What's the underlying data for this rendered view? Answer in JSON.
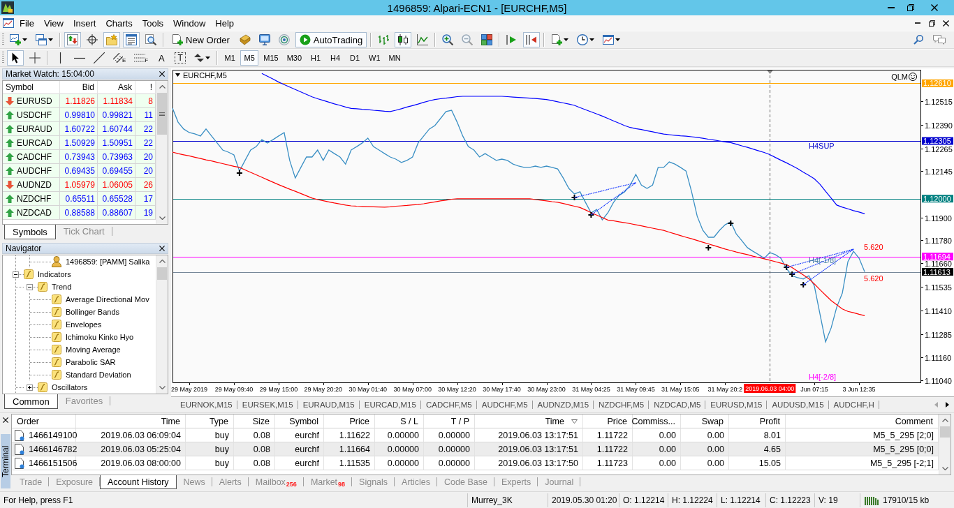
{
  "window": {
    "title": "1496859: Alpari-ECN1 - [EURCHF,M5]"
  },
  "menu": [
    "File",
    "View",
    "Insert",
    "Charts",
    "Tools",
    "Window",
    "Help"
  ],
  "toolbar": [
    {
      "items": [
        {
          "kind": "dropdown",
          "pressed": false
        },
        {
          "kind": "dropdown",
          "pressed": false
        }
      ]
    },
    {
      "items": [
        {
          "kind": "icon",
          "pressed": true
        },
        {
          "kind": "icon",
          "pressed": false
        },
        {
          "kind": "icon",
          "pressed": true
        },
        {
          "kind": "icon",
          "pressed": true
        },
        {
          "kind": "icon",
          "pressed": false
        }
      ]
    },
    {
      "items": [
        {
          "kind": "text",
          "label": "New Order",
          "pressed": false
        },
        {
          "kind": "icon",
          "pressed": false
        },
        {
          "kind": "icon",
          "pressed": false
        },
        {
          "kind": "icon",
          "pressed": false
        },
        {
          "kind": "text",
          "label": "AutoTrading",
          "pressed": true
        }
      ]
    },
    {
      "items": [
        {
          "kind": "icon",
          "pressed": false
        },
        {
          "kind": "icon",
          "pressed": true
        },
        {
          "kind": "icon",
          "pressed": false
        }
      ]
    },
    {
      "items": [
        {
          "kind": "icon",
          "pressed": false
        },
        {
          "kind": "icon",
          "pressed": false
        },
        {
          "kind": "icon",
          "pressed": false
        }
      ]
    },
    {
      "items": [
        {
          "kind": "icon",
          "pressed": false
        },
        {
          "kind": "icon",
          "pressed": true
        }
      ]
    },
    {
      "items": [
        {
          "kind": "dropdown",
          "pressed": false
        },
        {
          "kind": "dropdown",
          "pressed": false
        },
        {
          "kind": "dropdown",
          "pressed": false
        }
      ]
    }
  ],
  "drawing_toolbar": [
    {
      "items": [
        {
          "kind": "icon",
          "pressed": true
        },
        {
          "kind": "icon",
          "pressed": false
        }
      ]
    },
    {
      "items": [
        {
          "kind": "icon",
          "pressed": false
        },
        {
          "kind": "icon",
          "pressed": false
        },
        {
          "kind": "icon",
          "pressed": false
        },
        {
          "kind": "icon",
          "glyph": "E",
          "pressed": false
        },
        {
          "kind": "icon",
          "glyph": "F",
          "pressed": false
        },
        {
          "kind": "letter",
          "label": "A",
          "pressed": false
        },
        {
          "kind": "boxed",
          "label": "T",
          "pressed": false
        },
        {
          "kind": "dropdown",
          "pressed": false
        }
      ]
    }
  ],
  "timeframes": [
    {
      "label": "M1",
      "selected": false
    },
    {
      "label": "M5",
      "selected": true
    },
    {
      "label": "M15",
      "selected": false
    },
    {
      "label": "M30",
      "selected": false
    },
    {
      "label": "H1",
      "selected": false
    },
    {
      "label": "H4",
      "selected": false
    },
    {
      "label": "D1",
      "selected": false
    },
    {
      "label": "W1",
      "selected": false
    },
    {
      "label": "MN",
      "selected": false
    }
  ],
  "market_watch": {
    "title": "Market Watch: 15:04:00",
    "columns": [
      "Symbol",
      "Bid",
      "Ask",
      "!"
    ],
    "rows": [
      {
        "symbol": "EURUSD",
        "bid": "1.11826",
        "ask": "1.11834",
        "spread": "8",
        "rising": false
      },
      {
        "symbol": "USDCHF",
        "bid": "0.99810",
        "ask": "0.99821",
        "spread": "11",
        "rising": true
      },
      {
        "symbol": "EURAUD",
        "bid": "1.60722",
        "ask": "1.60744",
        "spread": "22",
        "rising": true
      },
      {
        "symbol": "EURCAD",
        "bid": "1.50929",
        "ask": "1.50951",
        "spread": "22",
        "rising": true
      },
      {
        "symbol": "CADCHF",
        "bid": "0.73943",
        "ask": "0.73963",
        "spread": "20",
        "rising": true
      },
      {
        "symbol": "AUDCHF",
        "bid": "0.69435",
        "ask": "0.69455",
        "spread": "20",
        "rising": true
      },
      {
        "symbol": "AUDNZD",
        "bid": "1.05979",
        "ask": "1.06005",
        "spread": "26",
        "rising": false
      },
      {
        "symbol": "NZDCHF",
        "bid": "0.65511",
        "ask": "0.65528",
        "spread": "17",
        "rising": true
      },
      {
        "symbol": "NZDCAD",
        "bid": "0.88588",
        "ask": "0.88607",
        "spread": "19",
        "rising": true
      }
    ],
    "tabs": [
      {
        "label": "Symbols",
        "selected": true
      },
      {
        "label": "Tick Chart",
        "selected": false
      }
    ]
  },
  "navigator": {
    "title": "Navigator",
    "tree": [
      {
        "label": "1496859: [PAMM] Salika",
        "kind": "account"
      },
      {
        "label": "Indicators",
        "kind": "folder",
        "expanded": true,
        "children": [
          {
            "label": "Trend",
            "expanded": true,
            "children": [
              {
                "label": "Average Directional Mov"
              },
              {
                "label": "Bollinger Bands"
              },
              {
                "label": "Envelopes"
              },
              {
                "label": "Ichimoku Kinko Hyo"
              },
              {
                "label": "Moving Average"
              },
              {
                "label": "Parabolic SAR"
              },
              {
                "label": "Standard Deviation"
              }
            ]
          },
          {
            "label": "Oscillators",
            "expanded": false
          }
        ]
      }
    ],
    "tabs": [
      {
        "label": "Common",
        "selected": true
      },
      {
        "label": "Favorites",
        "selected": false
      }
    ]
  },
  "chart": {
    "corner_label": "QLM",
    "price_tags": [
      {
        "text": "1.12610",
        "color": "#ffa500"
      },
      {
        "text": "1.12305",
        "color": "#0000cd"
      },
      {
        "text": "1.12000",
        "color": "#008080"
      },
      {
        "text": "1.11694",
        "color": "#ff00ff"
      },
      {
        "text": "1.11613",
        "color": "#000000"
      }
    ],
    "time_tag": {
      "text": "2019.06.03 04:00",
      "color": "#ff0000"
    },
    "chart_data": {
      "type": "line",
      "title": "EURCHF,M5",
      "categories": [
        null,
        null,
        null,
        "29 May 2019",
        null,
        null,
        null,
        null,
        null,
        null,
        null,
        "29 May 09:40",
        null,
        null,
        null,
        null,
        null,
        null,
        null,
        "29 May 15:00",
        null,
        null,
        null,
        null,
        null,
        null,
        null,
        "29 May 20:20",
        null,
        null,
        null,
        null,
        null,
        null,
        null,
        "30 May 01:40",
        null,
        null,
        null,
        null,
        null,
        null,
        null,
        "30 May 07:00",
        null,
        null,
        null,
        null,
        null,
        null,
        null,
        "30 May 12:20",
        null,
        null,
        null,
        null,
        null,
        null,
        null,
        "30 May 17:40",
        null,
        null,
        null,
        null,
        null,
        null,
        null,
        "30 May 23:00",
        null,
        null,
        null,
        null,
        null,
        null,
        null,
        "31 May 04:25",
        null,
        null,
        null,
        null,
        null,
        null,
        null,
        "31 May 09:45",
        null,
        null,
        null,
        null,
        null,
        null,
        null,
        "31 May 15:05",
        null,
        null,
        null,
        null,
        null,
        null,
        null,
        "31 May 20:2",
        null,
        null,
        null,
        null,
        null,
        null,
        null,
        null,
        null,
        null,
        null,
        null,
        null,
        null,
        null,
        "Jun 07:15",
        null,
        null,
        null,
        null,
        null,
        null,
        null,
        "3 Jun 12:35",
        null
      ],
      "series": [
        {
          "color": "#3a8fc4",
          "values": [
            1.12478,
            1.12404,
            1.12368,
            1.12349,
            1.12342,
            1.12331,
            1.12368,
            1.12331,
            1.12294,
            1.12257,
            1.12246,
            1.12231,
            1.12146,
            1.12202,
            1.12257,
            1.12275,
            1.12312,
            1.12294,
            1.12312,
            1.12331,
            1.12349,
            1.12202,
            1.12109,
            1.12165,
            1.1222,
            1.1222,
            1.12257,
            1.12202,
            1.12257,
            1.12238,
            1.1222,
            1.12183,
            1.12257,
            1.12275,
            1.12294,
            1.1232,
            1.12275,
            1.12257,
            1.12238,
            1.1222,
            1.12209,
            1.12191,
            1.12202,
            1.1222,
            1.12294,
            1.12331,
            1.12368,
            1.12386,
            1.12423,
            1.1246,
            1.12467,
            1.12404,
            1.12331,
            1.12275,
            1.12257,
            1.1222,
            1.12238,
            1.1222,
            1.12202,
            1.12209,
            1.12202,
            1.12183,
            1.12172,
            1.12165,
            1.12165,
            1.12172,
            1.12165,
            1.12172,
            1.12165,
            1.12157,
            1.12109,
            1.12054,
            1.12025,
            1.12036,
            1.1198,
            1.11925,
            1.11943,
            1.11888,
            1.11925,
            1.1198,
            1.12017,
            1.12036,
            1.12072,
            1.12128,
            1.12072,
            1.12054,
            1.12072,
            1.12165,
            1.12165,
            1.12194,
            1.12183,
            1.12165,
            1.12146,
            1.12036,
            1.11907,
            1.11833,
            1.11796,
            1.11796,
            1.11833,
            1.11862,
            1.11877,
            1.11814,
            1.11778,
            1.11741,
            1.11722,
            1.11704,
            1.11685,
            1.11715,
            1.11704,
            1.11685,
            1.1163,
            1.11593,
            1.11582,
            1.11575,
            1.11593,
            1.11538,
            1.1139,
            1.11243,
            1.11317,
            1.11427,
            1.11501,
            1.11667,
            1.11722,
            1.11685,
            1.11613
          ]
        },
        {
          "color": "#ff0000",
          "values": [
            1.12246,
            1.12238,
            1.12232,
            1.12226,
            1.12219,
            1.12212,
            1.12205,
            1.12199,
            1.12192,
            1.12185,
            1.12178,
            1.12171,
            1.12165,
            1.12152,
            1.12139,
            1.12126,
            1.12113,
            1.121,
            1.12087,
            1.12074,
            1.12062,
            1.1205,
            1.12039,
            1.12027,
            1.12015,
            1.12003,
            1.11995,
            1.11989,
            1.11983,
            1.11977,
            1.11972,
            1.11966,
            1.11962,
            1.1196,
            1.11959,
            1.11958,
            1.11957,
            1.11956,
            1.11955,
            1.11957,
            1.1196,
            1.11962,
            1.11964,
            1.11967,
            1.11969,
            1.11973,
            1.11978,
            1.11983,
            1.11988,
            1.11992,
            1.11997,
            1.11999,
            1.11999,
            1.11999,
            1.11999,
            1.11999,
            1.11999,
            1.11999,
            1.11999,
            1.11999,
            1.11999,
            1.11999,
            1.11999,
            1.11999,
            1.11999,
            1.11995,
            1.11992,
            1.11988,
            1.11984,
            1.11981,
            1.11974,
            1.11967,
            1.1196,
            1.11953,
            1.1194,
            1.11926,
            1.11913,
            1.119,
            1.11887,
            1.11883,
            1.11878,
            1.11873,
            1.11868,
            1.11862,
            1.11856,
            1.1185,
            1.11844,
            1.11838,
            1.11832,
            1.11823,
            1.11814,
            1.11805,
            1.11796,
            1.11788,
            1.11779,
            1.1177,
            1.11761,
            1.11752,
            1.11743,
            1.11734,
            1.11726,
            1.11718,
            1.11711,
            1.11704,
            1.11696,
            1.11689,
            1.11682,
            1.11675,
            1.11667,
            1.11659,
            1.11651,
            1.11636,
            1.11616,
            1.11597,
            1.11577,
            1.11549,
            1.11519,
            1.1149,
            1.11461,
            1.11439,
            1.11417,
            1.11404,
            1.11397,
            1.11389,
            1.11382
          ]
        },
        {
          "color": "#0000ff",
          "values": [
            null,
            null,
            null,
            null,
            null,
            null,
            null,
            null,
            null,
            null,
            null,
            null,
            null,
            null,
            null,
            null,
            1.12662,
            1.12647,
            1.12632,
            1.12616,
            1.12603,
            1.1259,
            1.12577,
            1.12564,
            1.12551,
            1.12538,
            1.12528,
            1.12519,
            1.1251,
            1.12501,
            1.12493,
            1.12484,
            1.12477,
            1.12475,
            1.12472,
            1.1247,
            1.12467,
            1.12465,
            1.12462,
            1.1246,
            1.12467,
            1.12475,
            1.12484,
            1.12492,
            1.125,
            1.12509,
            1.12517,
            1.12524,
            1.12528,
            1.12531,
            1.12535,
            1.12539,
            1.12541,
            1.12541,
            1.12541,
            1.12541,
            1.12541,
            1.12541,
            1.12541,
            1.12541,
            1.12539,
            1.12537,
            1.12535,
            1.12533,
            1.12531,
            1.12529,
            1.12527,
            1.12524,
            1.12518,
            1.12512,
            1.12506,
            1.125,
            1.12493,
            1.12481,
            1.1247,
            1.12459,
            1.12448,
            1.12436,
            1.12424,
            1.12411,
            1.12399,
            1.12386,
            1.12376,
            1.1237,
            1.12365,
            1.12359,
            1.12353,
            1.12347,
            1.12341,
            1.12338,
            1.12335,
            1.12332,
            1.1233,
            1.12327,
            1.12324,
            1.12319,
            1.12314,
            1.1231,
            1.12305,
            1.123,
            1.12296,
            1.12288,
            1.12279,
            1.12271,
            1.12262,
            1.12253,
            1.12244,
            1.12233,
            1.12218,
            1.12203,
            1.12189,
            1.12174,
            1.12158,
            1.1214,
            1.12123,
            1.12105,
            1.12076,
            1.12039,
            1.12003,
            1.11966,
            1.11955,
            1.11946,
            1.11937,
            1.11929,
            1.1192
          ]
        },
        {
          "color": "#2040ff",
          "line_style": "dotted",
          "values": [
            null,
            null,
            null,
            null,
            null,
            null,
            null,
            null,
            null,
            null,
            null,
            null,
            null,
            null,
            null,
            null,
            null,
            null,
            null,
            null,
            null,
            null,
            null,
            null,
            null,
            null,
            null,
            null,
            null,
            null,
            null,
            null,
            null,
            null,
            null,
            null,
            null,
            null,
            null,
            null,
            null,
            null,
            null,
            null,
            null,
            null,
            null,
            null,
            null,
            null,
            null,
            null,
            null,
            null,
            null,
            null,
            null,
            null,
            null,
            null,
            null,
            null,
            null,
            null,
            null,
            null,
            null,
            null,
            null,
            null,
            null,
            null,
            1.12006,
            1.12013,
            1.1202,
            1.12027,
            1.12034,
            1.12041,
            1.12049,
            1.12056,
            1.12063,
            1.1207,
            1.12077,
            1.12084,
            null,
            null,
            null,
            null,
            null,
            null,
            null,
            null,
            null,
            null,
            null,
            null,
            null,
            null,
            null,
            null,
            null,
            null,
            null,
            null,
            null,
            null,
            null,
            null,
            null,
            null,
            1.11637,
            1.11645,
            1.11653,
            1.11661,
            1.11669,
            1.11677,
            1.11685,
            1.11693,
            1.11701,
            1.11709,
            1.11717,
            1.11725,
            1.11733,
            null,
            null
          ]
        },
        {
          "color": "#2040ff",
          "line_style": "dotted",
          "values": [
            null,
            null,
            null,
            null,
            null,
            null,
            null,
            null,
            null,
            null,
            null,
            null,
            null,
            null,
            null,
            null,
            null,
            null,
            null,
            null,
            null,
            null,
            null,
            null,
            null,
            null,
            null,
            null,
            null,
            null,
            null,
            null,
            null,
            null,
            null,
            null,
            null,
            null,
            null,
            null,
            null,
            null,
            null,
            null,
            null,
            null,
            null,
            null,
            null,
            null,
            null,
            null,
            null,
            null,
            null,
            null,
            null,
            null,
            null,
            null,
            null,
            null,
            null,
            null,
            null,
            null,
            null,
            null,
            null,
            null,
            null,
            null,
            null,
            null,
            null,
            1.11914,
            1.11935,
            1.11956,
            1.11978,
            1.11999,
            1.1202,
            1.12042,
            1.12063,
            1.12084,
            null,
            null,
            null,
            null,
            null,
            null,
            null,
            null,
            null,
            null,
            null,
            null,
            null,
            null,
            null,
            null,
            null,
            null,
            null,
            null,
            null,
            null,
            null,
            null,
            null,
            null,
            null,
            1.11601,
            1.11613,
            1.11625,
            1.11637,
            1.11649,
            1.11661,
            1.11673,
            1.11685,
            1.11697,
            1.11709,
            1.11721,
            1.11733,
            null,
            null
          ]
        },
        {
          "color": "#2040ff",
          "line_style": "dotted",
          "values": [
            null,
            null,
            null,
            null,
            null,
            null,
            null,
            null,
            null,
            null,
            null,
            null,
            null,
            null,
            null,
            null,
            null,
            null,
            null,
            null,
            null,
            null,
            null,
            null,
            null,
            null,
            null,
            null,
            null,
            null,
            null,
            null,
            null,
            null,
            null,
            null,
            null,
            null,
            null,
            null,
            null,
            null,
            null,
            null,
            null,
            null,
            null,
            null,
            null,
            null,
            null,
            null,
            null,
            null,
            null,
            null,
            null,
            null,
            null,
            null,
            null,
            null,
            null,
            null,
            null,
            null,
            null,
            null,
            null,
            null,
            null,
            null,
            null,
            null,
            null,
            null,
            null,
            null,
            null,
            null,
            null,
            null,
            null,
            null,
            null,
            null,
            null,
            null,
            null,
            null,
            null,
            null,
            null,
            null,
            null,
            null,
            null,
            null,
            null,
            null,
            null,
            null,
            null,
            null,
            null,
            null,
            null,
            null,
            null,
            null,
            null,
            null,
            null,
            1.11545,
            1.11566,
            1.11587,
            1.11608,
            1.11629,
            1.1165,
            1.11671,
            1.11692,
            1.11712,
            1.11733,
            null,
            null
          ]
        },
        {
          "type": "scatter",
          "marker": "cross",
          "color": "#000000",
          "values": [
            null,
            null,
            null,
            null,
            null,
            null,
            null,
            null,
            null,
            null,
            null,
            null,
            1.12135,
            null,
            null,
            null,
            null,
            null,
            null,
            null,
            null,
            null,
            null,
            null,
            null,
            null,
            null,
            null,
            null,
            null,
            null,
            null,
            null,
            null,
            null,
            null,
            null,
            null,
            null,
            null,
            null,
            null,
            null,
            null,
            null,
            null,
            null,
            null,
            null,
            null,
            null,
            null,
            null,
            null,
            null,
            null,
            null,
            null,
            null,
            null,
            null,
            null,
            null,
            null,
            null,
            null,
            null,
            null,
            null,
            null,
            null,
            null,
            1.12006,
            null,
            null,
            1.11914,
            null,
            null,
            null,
            null,
            null,
            null,
            null,
            null,
            null,
            null,
            null,
            null,
            null,
            null,
            null,
            null,
            null,
            null,
            null,
            null,
            1.11741,
            null,
            null,
            null,
            1.1187,
            null,
            null,
            null,
            null,
            null,
            null,
            null,
            null,
            null,
            1.11637,
            1.11601,
            null,
            1.11545,
            null,
            null,
            null,
            null,
            null,
            null,
            null,
            null,
            null,
            null,
            null
          ]
        }
      ],
      "ylim": [
        1.11029,
        1.12681
      ],
      "yticks": [
        1.12515,
        {
          "value": 1.1239,
          "label": "1.12390"
        },
        1.12265,
        1.12145,
        {
          "value": 1.119,
          "label": "1.11900"
        },
        {
          "value": 1.1178,
          "label": "1.11780"
        },
        {
          "value": 1.1166,
          "label": "1.11660"
        },
        1.11535,
        {
          "value": 1.1141,
          "label": "1.11410"
        },
        1.11285,
        {
          "value": 1.1116,
          "label": "1.11160"
        },
        {
          "value": 1.1104,
          "label": "1.11040"
        }
      ],
      "ref_lines": [
        {
          "axis": "y",
          "value": 1.1261,
          "color": "#ffa500"
        },
        {
          "axis": "y",
          "value": 1.12305,
          "label": "H4SUP",
          "color": "#0000cd"
        },
        {
          "axis": "y",
          "value": 1.12,
          "color": "#008080"
        },
        {
          "axis": "y",
          "value": 1.11694,
          "color": "#ff00ff"
        },
        {
          "axis": "y",
          "value": 1.11613,
          "color": "#778899"
        }
      ],
      "annotations": [
        "5.620",
        "5.620",
        "H4[-1/8]",
        "H4[-2/8]"
      ]
    },
    "tabs": [
      {
        "label": "EURNOK,M15",
        "selected": false
      },
      {
        "label": "EURSEK,M15",
        "selected": false
      },
      {
        "label": "EURAUD,M15",
        "selected": false
      },
      {
        "label": "EURCAD,M15",
        "selected": false
      },
      {
        "label": "CADCHF,M5",
        "selected": false
      },
      {
        "label": "AUDCHF,M5",
        "selected": false
      },
      {
        "label": "AUDNZD,M15",
        "selected": false
      },
      {
        "label": "NZDCHF,M5",
        "selected": false
      },
      {
        "label": "NZDCAD,M5",
        "selected": false
      },
      {
        "label": "EURUSD,M15",
        "selected": false
      },
      {
        "label": "AUDUSD,M15",
        "selected": false
      },
      {
        "label": "AUDCHF,H",
        "selected": false
      }
    ]
  },
  "terminal": {
    "label": "Terminal",
    "columns": [
      {
        "label": "Order",
        "sorted": false
      },
      {
        "label": "Time",
        "sorted": false
      },
      {
        "label": "Type",
        "sorted": false
      },
      {
        "label": "Size",
        "sorted": false
      },
      {
        "label": "Symbol",
        "sorted": false
      },
      {
        "label": "Price",
        "sorted": false
      },
      {
        "label": "S / L",
        "sorted": false
      },
      {
        "label": "T / P",
        "sorted": false
      },
      {
        "label": "Time",
        "sorted": true
      },
      {
        "label": "Price",
        "sorted": false
      },
      {
        "label": "Commiss...",
        "sorted": false
      },
      {
        "label": "Swap",
        "sorted": false
      },
      {
        "label": "Profit",
        "sorted": false
      },
      {
        "label": "Comment",
        "sorted": false
      }
    ],
    "rows": [
      {
        "cells": [
          "1466149100",
          "2019.06.03 06:09:04",
          "buy",
          "0.08",
          "eurchf",
          "1.11622",
          "0.00000",
          "0.00000",
          "2019.06.03 13:17:51",
          "1.11722",
          "0.00",
          "0.00",
          "8.01",
          "M5_5_295 [2;0]"
        ]
      },
      {
        "cells": [
          "1466146782",
          "2019.06.03 05:25:04",
          "buy",
          "0.08",
          "eurchf",
          "1.11664",
          "0.00000",
          "0.00000",
          "2019.06.03 13:17:51",
          "1.11722",
          "0.00",
          "0.00",
          "4.65",
          "M5_5_295 [0;0]"
        ]
      },
      {
        "cells": [
          "1466151506",
          "2019.06.03 08:00:00",
          "buy",
          "0.08",
          "eurchf",
          "1.11535",
          "0.00000",
          "0.00000",
          "2019.06.03 13:17:50",
          "1.11723",
          "0.00",
          "0.00",
          "15.05",
          "M5_5_295 [-2;1]"
        ]
      }
    ],
    "tabs": [
      {
        "label": "Trade",
        "selected": false
      },
      {
        "label": "Exposure",
        "selected": false
      },
      {
        "label": "Account History",
        "selected": true
      },
      {
        "label": "News",
        "selected": false
      },
      {
        "label": "Alerts",
        "selected": false
      },
      {
        "label": "Mailbox",
        "badge": "256",
        "selected": false
      },
      {
        "label": "Market",
        "badge": "98",
        "selected": false
      },
      {
        "label": "Signals",
        "selected": false
      },
      {
        "label": "Articles",
        "selected": false
      },
      {
        "label": "Code Base",
        "selected": false
      },
      {
        "label": "Experts",
        "selected": false
      },
      {
        "label": "Journal",
        "selected": false
      }
    ]
  },
  "status_bar": {
    "sections": [
      "For Help, press F1",
      "Murrey_3K",
      "2019.05.30 01:20",
      "O: 1.12214",
      "H: 1.12224",
      "L: 1.12214",
      "C: 1.12223",
      "V: 19"
    ],
    "connection": "17910/15 kb"
  }
}
